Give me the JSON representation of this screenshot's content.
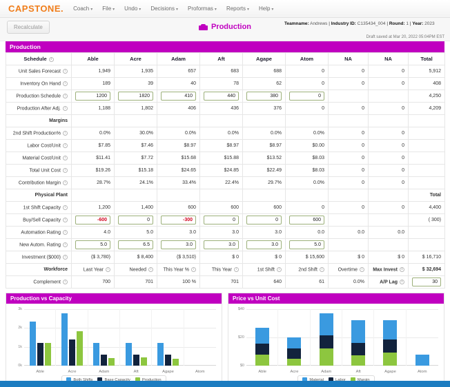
{
  "nav": {
    "logo": "CAPSTONE",
    "items": [
      {
        "label": "Coach"
      },
      {
        "label": "File"
      },
      {
        "label": "Undo"
      },
      {
        "label": "Decisions"
      },
      {
        "label": "Proformas"
      },
      {
        "label": "Reports"
      },
      {
        "label": "Help"
      }
    ]
  },
  "subheader": {
    "recalculate_label": "Recalculate",
    "page_title": "Production",
    "teamname_label": "Teamname:",
    "teamname_value": "Andrews",
    "industry_label": "Industry ID:",
    "industry_value": "C135434_004",
    "round_label": "Round:",
    "round_value": "1",
    "year_label": "Year:",
    "year_value": "2023",
    "draft_saved": "Draft saved at Mar 20, 2022 05:04PM EST",
    "separator": "|"
  },
  "panel": {
    "title": "Production",
    "columns": [
      "Schedule",
      "Able",
      "Acre",
      "Adam",
      "Aft",
      "Agape",
      "Atom",
      "NA",
      "NA",
      "Total"
    ],
    "sections": {
      "schedule": {
        "rows": [
          {
            "label": "Unit Sales Forecast",
            "values": [
              "1,949",
              "1,935",
              "657",
              "683",
              "688",
              "0",
              "0",
              "0"
            ],
            "total": "5,912"
          },
          {
            "label": "Inventory On Hand",
            "values": [
              "189",
              "39",
              "40",
              "78",
              "62",
              "0",
              "0",
              "0"
            ],
            "total": "408"
          },
          {
            "label": "Production Schedule",
            "inputs": [
              "1200",
              "1820",
              "410",
              "440",
              "380",
              "0"
            ],
            "values": [
              "",
              ""
            ],
            "total": "4,250"
          },
          {
            "label": "Production After Adj.",
            "values": [
              "1,188",
              "1,802",
              "406",
              "436",
              "376",
              "0",
              "0",
              "0"
            ],
            "total": "4,209"
          }
        ]
      },
      "margins": {
        "header": "Margins",
        "rows": [
          {
            "label": "2nd Shift Production%",
            "values": [
              "0.0%",
              "30.0%",
              "0.0%",
              "0.0%",
              "0.0%",
              "0.0%",
              "0",
              "0"
            ],
            "total": ""
          },
          {
            "label": "Labor Cost/Unit",
            "values": [
              "$7.85",
              "$7.46",
              "$8.97",
              "$8.97",
              "$8.97",
              "$0.00",
              "0",
              "0"
            ],
            "total": ""
          },
          {
            "label": "Material Cost/Unit",
            "values": [
              "$11.41",
              "$7.72",
              "$15.68",
              "$15.88",
              "$13.52",
              "$8.03",
              "0",
              "0"
            ],
            "total": ""
          },
          {
            "label": "Total Unit Cost",
            "values": [
              "$19.26",
              "$15.18",
              "$24.65",
              "$24.85",
              "$22.49",
              "$8.03",
              "0",
              "0"
            ],
            "total": ""
          },
          {
            "label": "Contribution Margin",
            "values": [
              "28.7%",
              "24.1%",
              "33.4%",
              "22.4%",
              "29.7%",
              "0.0%",
              "0",
              "0"
            ],
            "total": ""
          }
        ]
      },
      "physical_plant": {
        "header": "Physical Plant",
        "total_header": "Total",
        "rows": [
          {
            "label": "1st Shift Capacity",
            "values": [
              "1,200",
              "1,400",
              "600",
              "600",
              "600",
              "0",
              "0",
              "0"
            ],
            "total": "4,400"
          },
          {
            "label": "Buy/Sell Capacity",
            "inputs": [
              "-600",
              "0",
              "-300",
              "0",
              "0",
              "600"
            ],
            "input_negative": [
              true,
              false,
              true,
              false,
              false,
              false
            ],
            "total": "( 300)",
            "total_negative": true
          },
          {
            "label": "Automation Rating",
            "values": [
              "4.0",
              "5.0",
              "3.0",
              "3.0",
              "3.0",
              "0.0",
              "0.0",
              "0.0"
            ],
            "total": ""
          },
          {
            "label": "New Autom. Rating",
            "inputs": [
              "5.0",
              "6.5",
              "3.0",
              "3.0",
              "3.0",
              "5.0"
            ],
            "total": ""
          },
          {
            "label": "Investment ($000)",
            "values": [
              "($ 3,780)",
              "$ 8,400",
              "($ 3,510)",
              "$ 0",
              "$ 0",
              "$ 15,600",
              "$ 0",
              "$ 0"
            ],
            "negatives": [
              true,
              false,
              true,
              false,
              false,
              false,
              false,
              false
            ],
            "total": "$ 16,710"
          }
        ]
      },
      "workforce": {
        "header": "Workforce",
        "header_cells": [
          "Last Year",
          "Needed",
          "This Year %",
          "This Year",
          "1st Shift",
          "2nd Shift",
          "Overtime",
          "Max Invest"
        ],
        "max_invest_value": "$ 32,694",
        "row": {
          "label": "Complement",
          "values": [
            "700",
            "701",
            "100 %",
            "701",
            "640",
            "61",
            "0.0%"
          ],
          "ap_lag_label": "A/P Lag",
          "ap_lag_value": "30"
        }
      }
    }
  },
  "chart_data": [
    {
      "type": "bar",
      "title": "Production vs Capacity",
      "categories": [
        "Able",
        "Acre",
        "Adam",
        "Aft",
        "Agape",
        "Atom"
      ],
      "series": [
        {
          "name": "Both Shifts",
          "color": "#3a9ae0",
          "values": [
            2350,
            2800,
            1200,
            1200,
            1200,
            0
          ]
        },
        {
          "name": "Base Capacity",
          "color": "#12233d",
          "values": [
            1200,
            1400,
            600,
            600,
            600,
            0
          ]
        },
        {
          "name": "Production",
          "color": "#8dc63f",
          "values": [
            1200,
            1830,
            420,
            440,
            380,
            0
          ]
        }
      ],
      "ylabel": "",
      "xlabel": "",
      "yticks": [
        "0k",
        "1k",
        "2k",
        "3k"
      ],
      "ylim": [
        0,
        3000
      ],
      "grid": true,
      "legend_position": "bottom"
    },
    {
      "type": "bar",
      "title": "Price vs Unit Cost",
      "stacked": true,
      "categories": [
        "Able",
        "Acre",
        "Adam",
        "Aft",
        "Agape",
        "Atom"
      ],
      "series": [
        {
          "name": "Margin",
          "color": "#8dc63f",
          "values": [
            7.74,
            4.82,
            12.36,
            7.18,
            9.51,
            0
          ]
        },
        {
          "name": "Labor",
          "color": "#12233d",
          "values": [
            7.85,
            7.46,
            8.97,
            8.97,
            8.97,
            0
          ]
        },
        {
          "name": "Material",
          "color": "#3a9ae0",
          "values": [
            11.41,
            7.72,
            15.68,
            15.88,
            13.52,
            8.03
          ]
        }
      ],
      "legend_order": [
        "Material",
        "Labor",
        "Margin"
      ],
      "yticks": [
        "$0",
        "$20",
        "$40"
      ],
      "ylim": [
        0,
        40
      ],
      "grid": true,
      "legend_position": "bottom"
    }
  ]
}
